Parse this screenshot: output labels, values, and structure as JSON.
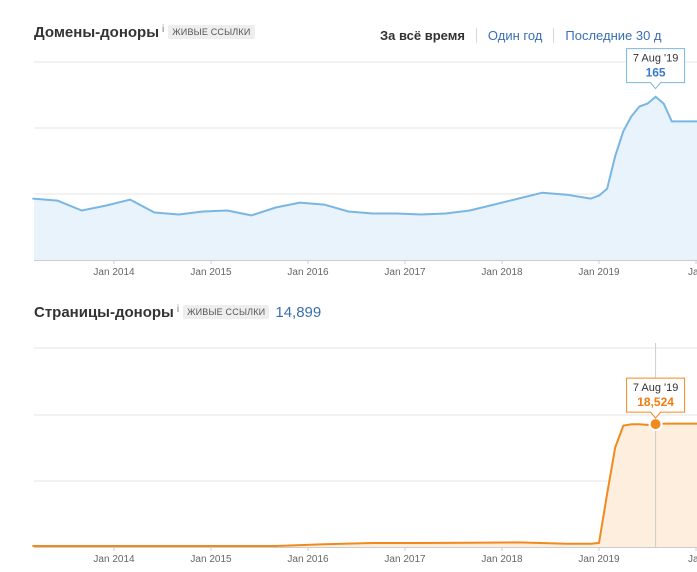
{
  "range_tabs": [
    "За всё время",
    "Один год",
    "Последние 30 д"
  ],
  "colors": {
    "blue_line": "#7ab6e2",
    "blue_fill": "#e8f3fc",
    "blue_text": "#3a7bc8",
    "orange_line": "#f08a1f",
    "orange_fill": "#fdeede",
    "orange_text": "#ee7d12",
    "grid": "#e6e6e6"
  },
  "sections": [
    {
      "title": "Домены-доноры",
      "info": "i",
      "badge": "ЖИВЫЕ ССЫЛКИ",
      "count": ""
    },
    {
      "title": "Страницы-доноры",
      "info": "i",
      "badge": "ЖИВЫЕ ССЫЛКИ",
      "count": "14,899"
    }
  ],
  "chart_data": [
    {
      "type": "area",
      "x_ticks": [
        "Jan 2014",
        "Jan 2015",
        "Jan 2016",
        "Jan 2017",
        "Jan 2018",
        "Jan 2019",
        "Jan"
      ],
      "x_range": [
        "2013-01",
        "2020-01"
      ],
      "ylim": [
        0,
        200
      ],
      "grid": true,
      "x": [
        "2013-03",
        "2013-06",
        "2013-09",
        "2013-12",
        "2014-03",
        "2014-06",
        "2014-09",
        "2014-12",
        "2015-03",
        "2015-06",
        "2015-09",
        "2015-12",
        "2016-03",
        "2016-06",
        "2016-09",
        "2016-12",
        "2017-03",
        "2017-06",
        "2017-09",
        "2017-12",
        "2018-03",
        "2018-06",
        "2018-09",
        "2018-12",
        "2019-01",
        "2019-02",
        "2019-03",
        "2019-04",
        "2019-05",
        "2019-06",
        "2019-07",
        "2019-08",
        "2019-09",
        "2019-10"
      ],
      "values": [
        62,
        60,
        50,
        55,
        61,
        48,
        46,
        49,
        50,
        45,
        53,
        58,
        56,
        49,
        47,
        47,
        46,
        47,
        50,
        56,
        62,
        68,
        66,
        62,
        65,
        72,
        105,
        130,
        145,
        155,
        158,
        165,
        158,
        140
      ],
      "tooltip": {
        "date": "7 Aug '19",
        "value": "165"
      }
    },
    {
      "type": "area",
      "x_ticks": [
        "Jan 2014",
        "Jan 2015",
        "Jan 2016",
        "Jan 2017",
        "Jan 2018",
        "Jan 2019",
        "Jan"
      ],
      "x_range": [
        "2013-01",
        "2020-01"
      ],
      "ylim": [
        0,
        30000
      ],
      "grid": true,
      "x": [
        "2013-03",
        "2013-09",
        "2014-03",
        "2014-09",
        "2015-03",
        "2015-09",
        "2016-03",
        "2016-09",
        "2017-03",
        "2017-09",
        "2018-03",
        "2018-09",
        "2018-12",
        "2019-01",
        "2019-02",
        "2019-03",
        "2019-04",
        "2019-05",
        "2019-06",
        "2019-07",
        "2019-08",
        "2019-09",
        "2019-10"
      ],
      "values": [
        150,
        150,
        150,
        150,
        150,
        150,
        400,
        600,
        600,
        650,
        700,
        500,
        500,
        600,
        8000,
        15000,
        18300,
        18500,
        18500,
        18400,
        18524,
        18600,
        18600
      ],
      "tooltip": {
        "date": "7 Aug '19",
        "value": "18,524"
      }
    }
  ]
}
